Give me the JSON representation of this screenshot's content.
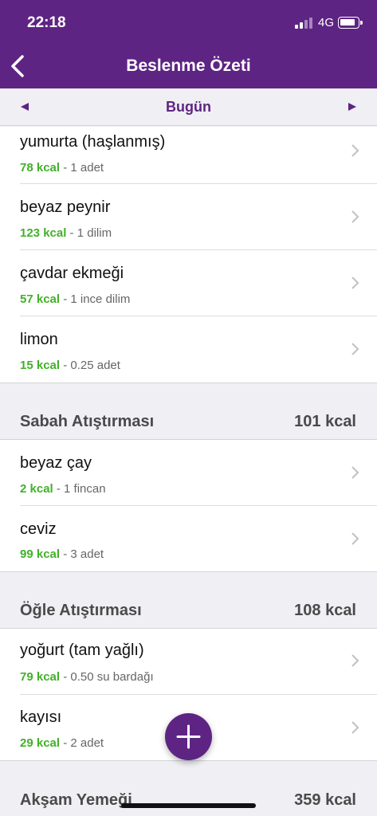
{
  "status_bar": {
    "time": "22:18",
    "network": "4G"
  },
  "header": {
    "title": "Beslenme Özeti"
  },
  "date_nav": {
    "label": "Bugün"
  },
  "items_top": [
    {
      "name": "yumurta (haşlanmış)",
      "kcal": "78 kcal",
      "detail": " - 1 adet"
    },
    {
      "name": "beyaz peynir",
      "kcal": "123 kcal",
      "detail": " - 1 dilim"
    },
    {
      "name": "çavdar ekmeği",
      "kcal": "57 kcal",
      "detail": " - 1 ince dilim"
    },
    {
      "name": "limon",
      "kcal": "15 kcal",
      "detail": " - 0.25 adet"
    }
  ],
  "sections": [
    {
      "title": "Sabah Atıştırması",
      "total": "101 kcal",
      "items": [
        {
          "name": "beyaz çay",
          "kcal": "2 kcal",
          "detail": " - 1 fincan"
        },
        {
          "name": "ceviz",
          "kcal": "99 kcal",
          "detail": " - 3 adet"
        }
      ]
    },
    {
      "title": "Öğle Atıştırması",
      "total": "108 kcal",
      "items": [
        {
          "name": "yoğurt (tam yağlı)",
          "kcal": "79 kcal",
          "detail": " - 0.50 su bardağı"
        },
        {
          "name": "kayısı",
          "kcal": "29 kcal",
          "detail": " - 2 adet"
        }
      ]
    },
    {
      "title": "Akşam Yemeği",
      "total": "359 kcal",
      "items": []
    }
  ],
  "icons": {
    "back": "chevron-left-icon",
    "prev": "triangle-left-icon",
    "next": "triangle-right-icon",
    "row": "chevron-right-icon",
    "add": "plus-icon"
  },
  "colors": {
    "brand": "#5e2483",
    "kcal": "#43b02a",
    "background": "#efeff4"
  }
}
